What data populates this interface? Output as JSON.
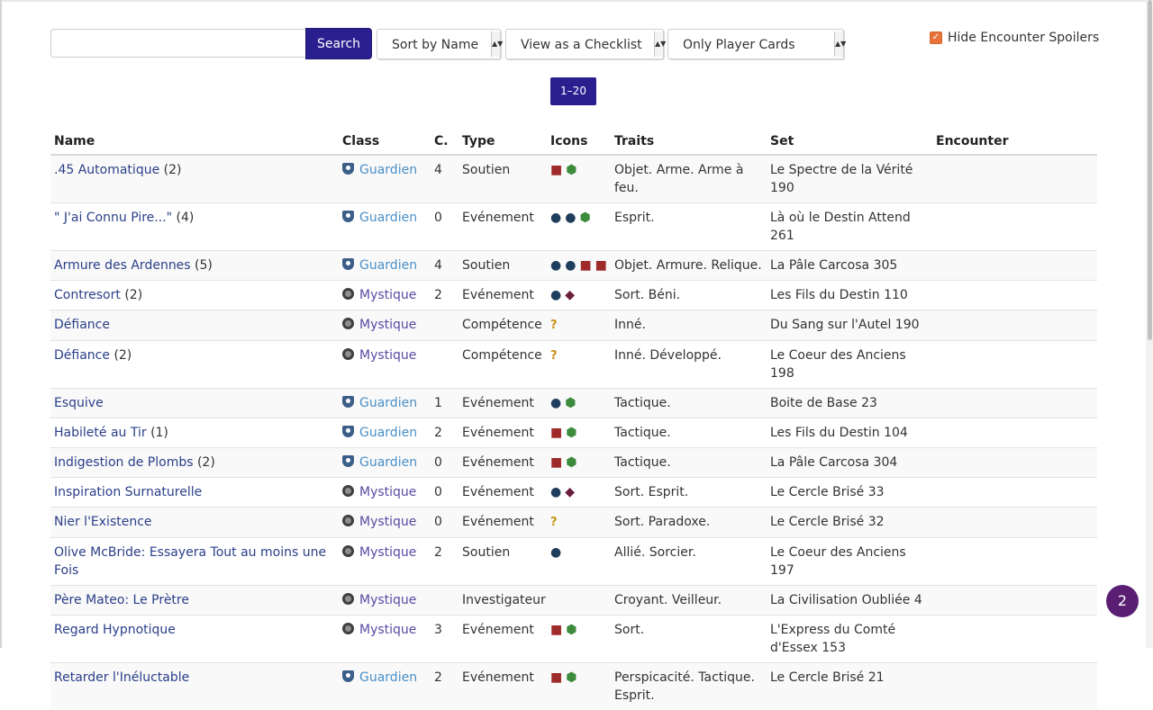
{
  "toolbar": {
    "search_value": "",
    "search_label": "Search",
    "sort_label": "Sort by Name",
    "view_label": "View as a Checklist",
    "filter_label": "Only Player Cards"
  },
  "spoilers": {
    "label": "Hide Encounter Spoilers",
    "checked": true
  },
  "pager": {
    "label": "1–20"
  },
  "table": {
    "headers": [
      "Name",
      "Class",
      "C.",
      "Type",
      "Icons",
      "Traits",
      "Set",
      "Encounter"
    ],
    "rows": [
      {
        "name": ".45 Automatique",
        "qty": "(2)",
        "class": "Guardien",
        "cost": "4",
        "type": "Soutien",
        "icons": [
          "combat",
          "agility"
        ],
        "traits": "Objet. Arme. Arme à feu.",
        "set": "Le Spectre de la Vérité 190",
        "encounter": ""
      },
      {
        "name": "\" J'ai Connu Pire...\"",
        "qty": "(4)",
        "class": "Guardien",
        "cost": "0",
        "type": "Evénement",
        "icons": [
          "willpower",
          "willpower",
          "agility"
        ],
        "traits": "Esprit.",
        "set": "Là où le Destin Attend 261",
        "encounter": ""
      },
      {
        "name": "Armure des Ardennes",
        "qty": "(5)",
        "class": "Guardien",
        "cost": "4",
        "type": "Soutien",
        "icons": [
          "willpower",
          "willpower",
          "combat",
          "combat"
        ],
        "traits": "Objet. Armure. Relique.",
        "set": "La Pâle Carcosa 305",
        "encounter": ""
      },
      {
        "name": "Contresort",
        "qty": "(2)",
        "class": "Mystique",
        "cost": "2",
        "type": "Evénement",
        "icons": [
          "willpower",
          "intellect"
        ],
        "traits": "Sort. Béni.",
        "set": "Les Fils du Destin 110",
        "encounter": ""
      },
      {
        "name": "Défiance",
        "qty": "",
        "class": "Mystique",
        "cost": "",
        "type": "Compétence",
        "icons": [
          "wild"
        ],
        "traits": "Inné.",
        "set": "Du Sang sur l'Autel 190",
        "encounter": ""
      },
      {
        "name": "Défiance",
        "qty": "(2)",
        "class": "Mystique",
        "cost": "",
        "type": "Compétence",
        "icons": [
          "wild"
        ],
        "traits": "Inné. Développé.",
        "set": "Le Coeur des Anciens 198",
        "encounter": ""
      },
      {
        "name": "Esquive",
        "qty": "",
        "class": "Guardien",
        "cost": "1",
        "type": "Evénement",
        "icons": [
          "willpower",
          "agility"
        ],
        "traits": "Tactique.",
        "set": "Boite de Base 23",
        "encounter": ""
      },
      {
        "name": "Habileté au Tir",
        "qty": "(1)",
        "class": "Guardien",
        "cost": "2",
        "type": "Evénement",
        "icons": [
          "combat",
          "agility"
        ],
        "traits": "Tactique.",
        "set": "Les Fils du Destin 104",
        "encounter": ""
      },
      {
        "name": "Indigestion de Plombs",
        "qty": "(2)",
        "class": "Guardien",
        "cost": "0",
        "type": "Evénement",
        "icons": [
          "combat",
          "agility"
        ],
        "traits": "Tactique.",
        "set": "La Pâle Carcosa 304",
        "encounter": ""
      },
      {
        "name": "Inspiration Surnaturelle",
        "qty": "",
        "class": "Mystique",
        "cost": "0",
        "type": "Evénement",
        "icons": [
          "willpower",
          "intellect"
        ],
        "traits": "Sort. Esprit.",
        "set": "Le Cercle Brisé 33",
        "encounter": ""
      },
      {
        "name": "Nier l'Existence",
        "qty": "",
        "class": "Mystique",
        "cost": "0",
        "type": "Evénement",
        "icons": [
          "wild"
        ],
        "traits": "Sort. Paradoxe.",
        "set": "Le Cercle Brisé 32",
        "encounter": ""
      },
      {
        "name": "Olive McBride: Essayera Tout au moins une Fois",
        "qty": "",
        "class": "Mystique",
        "cost": "2",
        "type": "Soutien",
        "icons": [
          "willpower"
        ],
        "traits": "Allié. Sorcier.",
        "set": "Le Coeur des Anciens 197",
        "encounter": ""
      },
      {
        "name": "Père Mateo: Le Prètre",
        "qty": "",
        "class": "Mystique",
        "cost": "",
        "type": "Investigateur",
        "icons": [],
        "traits": "Croyant. Veilleur.",
        "set": "La Civilisation Oubliée 4",
        "encounter": ""
      },
      {
        "name": "Regard Hypnotique",
        "qty": "",
        "class": "Mystique",
        "cost": "3",
        "type": "Evénement",
        "icons": [
          "combat",
          "agility"
        ],
        "traits": "Sort.",
        "set": "L'Express du Comté d'Essex 153",
        "encounter": ""
      },
      {
        "name": "Retarder l'Inéluctable",
        "qty": "",
        "class": "Guardien",
        "cost": "2",
        "type": "Evénement",
        "icons": [
          "combat",
          "agility"
        ],
        "traits": "Perspicacité. Tactique. Esprit.",
        "set": "Le Cercle Brisé 21",
        "encounter": ""
      }
    ]
  },
  "help": {
    "label": "2"
  },
  "colors": {
    "accent": "#2a1f8f",
    "guardian": "#4a8fc7",
    "mystic": "#5a4aa3",
    "link": "#2a3f88",
    "checkbox": "#e8743b",
    "help_bubble": "#5a1f73"
  }
}
